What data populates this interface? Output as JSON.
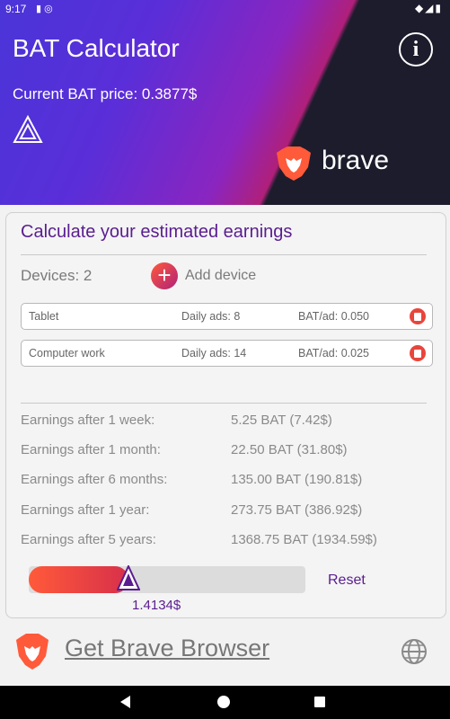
{
  "status_bar": {
    "time": "9:17",
    "left_icons": "▮ ◎",
    "right_icons": "◆◢▮"
  },
  "header": {
    "title": "BAT Calculator",
    "price_label": "Current BAT price: 0.3877$",
    "brand_word": "brave"
  },
  "calculator": {
    "title": "Calculate your estimated earnings",
    "devices_label": "Devices: 2",
    "add_label": "Add device",
    "devices": [
      {
        "name": "Tablet",
        "ads": "Daily ads: 8",
        "bat": "BAT/ad: 0.050"
      },
      {
        "name": "Computer work",
        "ads": "Daily ads: 14",
        "bat": "BAT/ad: 0.025"
      }
    ],
    "earnings": [
      {
        "label": "Earnings after 1 week:",
        "value": "5.25 BAT (7.42$)"
      },
      {
        "label": "Earnings after 1 month:",
        "value": "22.50 BAT (31.80$)"
      },
      {
        "label": "Earnings after 6 months:",
        "value": "135.00 BAT (190.81$)"
      },
      {
        "label": "Earnings after 1 year:",
        "value": "273.75 BAT (386.92$)"
      },
      {
        "label": "Earnings after 5 years:",
        "value": "1368.75 BAT (1934.59$)"
      }
    ],
    "slider_fraction": 0.36,
    "slider_value": "1.4134$",
    "reset_label": "Reset"
  },
  "footer": {
    "link_label": "Get Brave Browser"
  },
  "colors": {
    "accent": "#5a1d8f",
    "orange": "#ff5a3a",
    "header_dark": "#1c1c2c"
  }
}
